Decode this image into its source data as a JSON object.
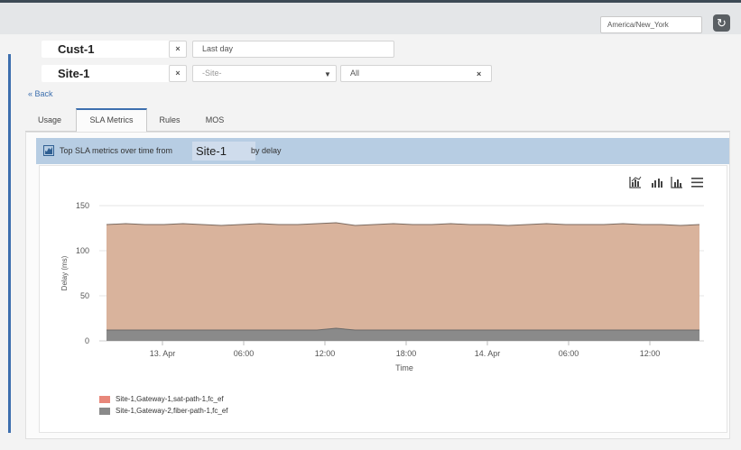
{
  "header": {
    "timezone": "America/New_York",
    "refresh_icon": "refresh-icon"
  },
  "filters": {
    "customer": "Cust-1",
    "time_range": "Last day",
    "site": "Site-1",
    "path_placeholder": "-Site-",
    "scope": "All",
    "clear_label": "×"
  },
  "nav": {
    "back_label": "Back"
  },
  "tabs": [
    {
      "label": "Usage",
      "active": false
    },
    {
      "label": "SLA Metrics",
      "active": true
    },
    {
      "label": "Rules",
      "active": false
    },
    {
      "label": "MOS",
      "active": false
    }
  ],
  "panel": {
    "title_prefix": "Top SLA metrics over time from",
    "site": "Site-1",
    "title_suffix": "by delay"
  },
  "chart_data": {
    "type": "area",
    "title": "",
    "xlabel": "Time",
    "ylabel": "Delay (ms)",
    "ylim": [
      0,
      150
    ],
    "yticks": [
      0,
      50,
      100,
      150
    ],
    "xticks": [
      "13. Apr",
      "06:00",
      "12:00",
      "18:00",
      "14. Apr",
      "06:00",
      "12:00"
    ],
    "grid": true,
    "legend_position": "bottom-left",
    "stacked": true,
    "series": [
      {
        "name": "Site-1,Gateway-1,sat-path-1,fc_ef",
        "color": "#e8877a",
        "fill": "#d9b39c",
        "values": [
          117,
          118,
          117,
          117,
          118,
          117,
          116,
          117,
          118,
          117,
          117,
          118,
          117,
          116,
          117,
          118,
          117,
          117,
          118,
          117,
          117,
          116,
          117,
          118,
          117,
          117,
          117,
          118,
          117,
          117,
          116,
          117
        ]
      },
      {
        "name": "Site-1,Gateway-2,fiber-path-1,fc_ef",
        "color": "#9a9a9a",
        "fill": "#8a8a8a",
        "values": [
          12,
          12,
          12,
          12,
          12,
          12,
          12,
          12,
          12,
          12,
          12,
          12,
          14,
          12,
          12,
          12,
          12,
          12,
          12,
          12,
          12,
          12,
          12,
          12,
          12,
          12,
          12,
          12,
          12,
          12,
          12,
          12
        ]
      }
    ]
  }
}
